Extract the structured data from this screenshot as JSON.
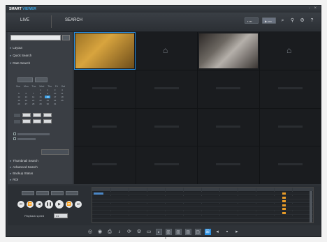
{
  "window": {
    "title_main": "SMART",
    "title_accent": "VIEWER",
    "controls": "- ×"
  },
  "tabs": [
    {
      "label": "LIVE"
    },
    {
      "label": "SEARCH"
    }
  ],
  "toolbar": {
    "btn1": "▪ ▪▪▪",
    "btn2": "▶ ▪▪▪▪"
  },
  "left_panel": {
    "sections": [
      "Layout",
      "Quick Search",
      "Date Search",
      "Thumbnail Search",
      "Advanced Search",
      "Backup Status",
      "ROI"
    ]
  },
  "calendar": {
    "weekdays": [
      "Sun",
      "Mon",
      "Tue",
      "Wed",
      "Thu",
      "Fri",
      "Sat"
    ],
    "rows": [
      [
        "",
        "",
        "",
        "1",
        "2",
        "3",
        "4"
      ],
      [
        "5",
        "6",
        "7",
        "8",
        "9",
        "10",
        "11"
      ],
      [
        "12",
        "13",
        "14",
        "15",
        "16",
        "17",
        "18"
      ],
      [
        "19",
        "20",
        "21",
        "22",
        "23",
        "24",
        "25"
      ],
      [
        "26",
        "27",
        "28",
        "29",
        "30",
        "31",
        ""
      ]
    ],
    "selected": "16"
  },
  "playback": {
    "speed_label": "Playback speed",
    "speed_value": "x1"
  },
  "colors": {
    "accent": "#3aa8e8",
    "record": "#4a86c5",
    "event": "#e89b27"
  },
  "icons": [
    "capture-icon",
    "record-icon",
    "print-icon",
    "audio-icon",
    "settings-icon",
    "grid-icon"
  ]
}
